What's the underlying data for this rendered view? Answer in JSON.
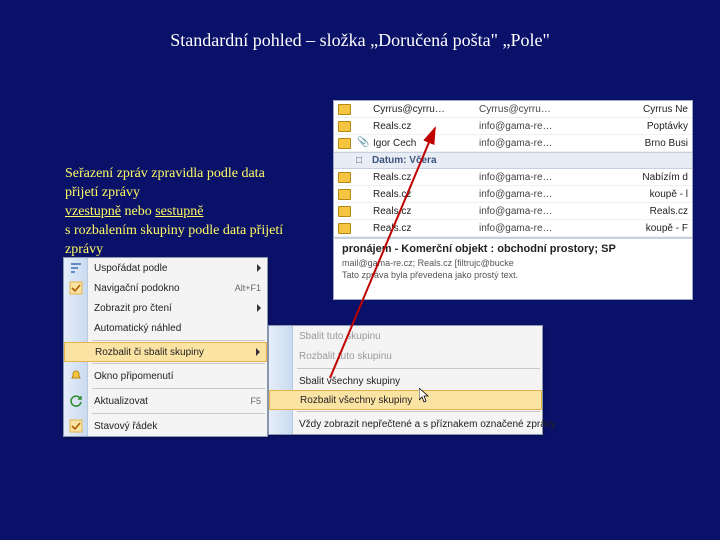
{
  "title": "Standardní pohled – složka „Doručená pošta\" „Pole\"",
  "description": {
    "line1": "Seřazení zpráv zpravidla podle data přijetí zprávy",
    "asc": "vzestupně",
    "or": " nebo ",
    "desc": "sestupně",
    "line3": "s rozbalením skupiny podle data přijetí zprávy"
  },
  "inbox": {
    "topRows": [
      {
        "from": "Cyrrus@cyrru…",
        "email": "Cyrrus@cyrru…",
        "right": "Cyrrus Ne"
      },
      {
        "from": "Reals.cz",
        "email": "info@gama-re…",
        "right": "Poptávky"
      },
      {
        "from": "Igor Čech",
        "email": "info@gama-re…",
        "right": "Brno Busi",
        "att": true
      }
    ],
    "groupHeader": "Datum: Včera",
    "rows": [
      {
        "from": "Reals.cz",
        "email": "info@gama-re…",
        "right": "Nabízím d"
      },
      {
        "from": "Reals.cz",
        "email": "info@gama-re…",
        "right": "koupě - l"
      },
      {
        "from": "Reals.cz",
        "email": "info@gama-re…",
        "right": "Reals.cz"
      },
      {
        "from": "Reals.cz",
        "email": "info@gama-re…",
        "right": "koupě - F"
      }
    ],
    "preview": {
      "subject": "pronájem - Komerční objekt : obchodní prostory; SP",
      "meta1": "mail@gama-re.cz; Reals.cz [filtrujc@bucke",
      "meta2": "Tato zpráva byla převedena jako prostý text."
    }
  },
  "contextMenu": {
    "items": [
      {
        "label": "Uspořádat podle",
        "icon": "sort",
        "arrow": true
      },
      {
        "label": "Navigační podokno",
        "icon": "check",
        "hot": "Alt+F1"
      },
      {
        "label": "Zobrazit pro čtení",
        "icon": "",
        "arrow": true
      },
      {
        "label": "Automatický náhled",
        "icon": ""
      },
      {
        "sep": true
      },
      {
        "label": "Rozbalit či sbalit skupiny",
        "icon": "",
        "arrow": true,
        "hl": true
      },
      {
        "sep": true
      },
      {
        "label": "Okno připomenutí",
        "icon": "bell"
      },
      {
        "sep": true
      },
      {
        "label": "Aktualizovat",
        "icon": "refresh",
        "hot": "F5"
      },
      {
        "sep": true
      },
      {
        "label": "Stavový řádek",
        "icon": "check"
      }
    ]
  },
  "submenu": {
    "items": [
      {
        "label": "Sbalit tuto skupinu",
        "dis": true
      },
      {
        "label": "Rozbalit tuto skupinu",
        "dis": true
      },
      {
        "sep": true
      },
      {
        "label": "Sbalit všechny skupiny"
      },
      {
        "label": "Rozbalit všechny skupiny",
        "hl": true
      },
      {
        "sep": true
      },
      {
        "label": "Vždy zobrazit nepřečtené a s příznakem označené zprávy"
      }
    ]
  }
}
